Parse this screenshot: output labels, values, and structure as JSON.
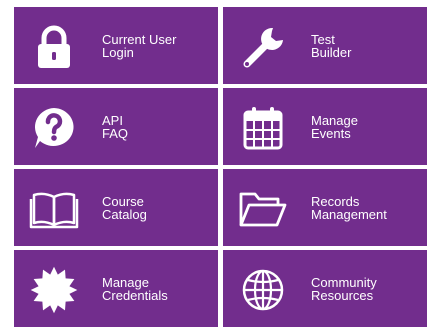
{
  "tiles": [
    {
      "line1": "Current User",
      "line2": "Login",
      "icon": "lock-icon"
    },
    {
      "line1": "Test",
      "line2": "Builder",
      "icon": "wrench-icon"
    },
    {
      "line1": "API",
      "line2": "FAQ",
      "icon": "question-icon"
    },
    {
      "line1": "Manage",
      "line2": "Events",
      "icon": "calendar-icon"
    },
    {
      "line1": "Course",
      "line2": "Catalog",
      "icon": "book-icon"
    },
    {
      "line1": "Records",
      "line2": "Management",
      "icon": "folder-icon"
    },
    {
      "line1": "Manage",
      "line2": "Credentials",
      "icon": "badge-icon"
    },
    {
      "line1": "Community",
      "line2": "Resources",
      "icon": "globe-icon"
    }
  ],
  "colors": {
    "tile_background": "#722d8d",
    "tile_text": "#ffffff",
    "page_background": "#ffffff"
  }
}
